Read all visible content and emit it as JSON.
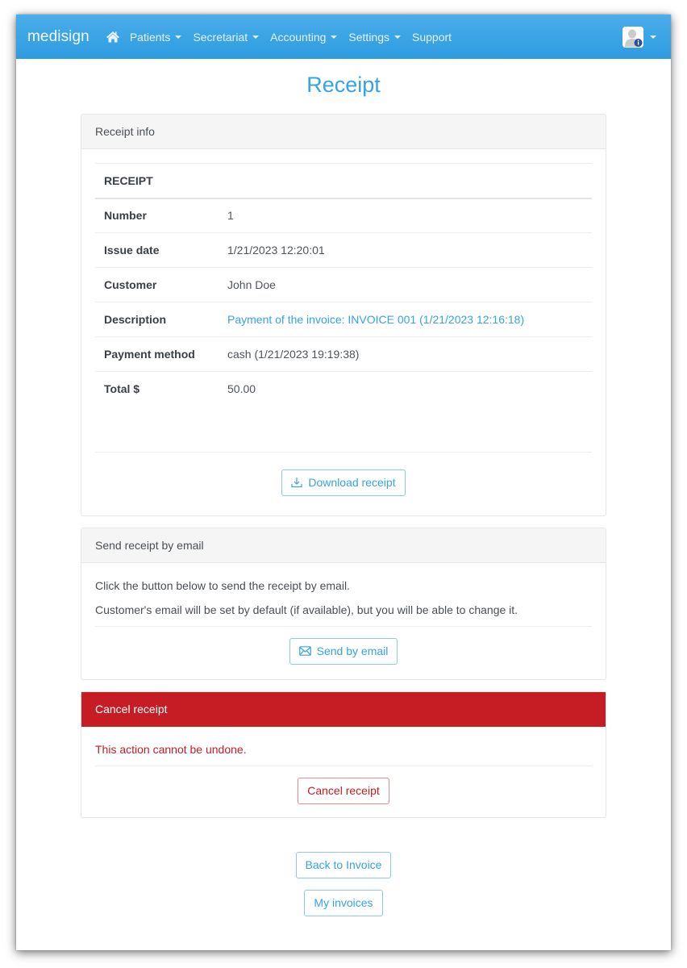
{
  "navbar": {
    "brand": "medisign",
    "home_icon": "home-icon",
    "items": [
      {
        "label": "Patients",
        "dropdown": true
      },
      {
        "label": "Secretariat",
        "dropdown": true
      },
      {
        "label": "Accounting",
        "dropdown": true
      },
      {
        "label": "Settings",
        "dropdown": true
      },
      {
        "label": "Support",
        "dropdown": false
      }
    ],
    "user_icon": "user-avatar-icon",
    "accent_color": "#2e9be0"
  },
  "page": {
    "title": "Receipt"
  },
  "receipt_info": {
    "header": "Receipt info",
    "table_heading": "RECEIPT",
    "rows": [
      {
        "label": "Number",
        "value": "1"
      },
      {
        "label": "Issue date",
        "value": "1/21/2023 12:20:01"
      },
      {
        "label": "Customer",
        "value": "John Doe"
      },
      {
        "label": "Description",
        "value": "Payment of the invoice: INVOICE 001 (1/21/2023 12:16:18)",
        "is_link": true
      },
      {
        "label": "Payment method",
        "value": "cash (1/21/2023 19:19:38)"
      },
      {
        "label": "Total $",
        "value": "50.00"
      }
    ],
    "download_button": "Download receipt"
  },
  "email_section": {
    "header": "Send receipt by email",
    "text1": "Click the button below to send the receipt by email.",
    "text2": "Customer's email will be set by default (if available), but you will be able to change it.",
    "send_button": "Send by email"
  },
  "cancel_section": {
    "header": "Cancel receipt",
    "warning": "This action cannot be undone.",
    "cancel_button": "Cancel receipt",
    "danger_color": "#c61c23"
  },
  "bottom_actions": {
    "back_button": "Back to Invoice",
    "invoices_button": "My invoices"
  }
}
